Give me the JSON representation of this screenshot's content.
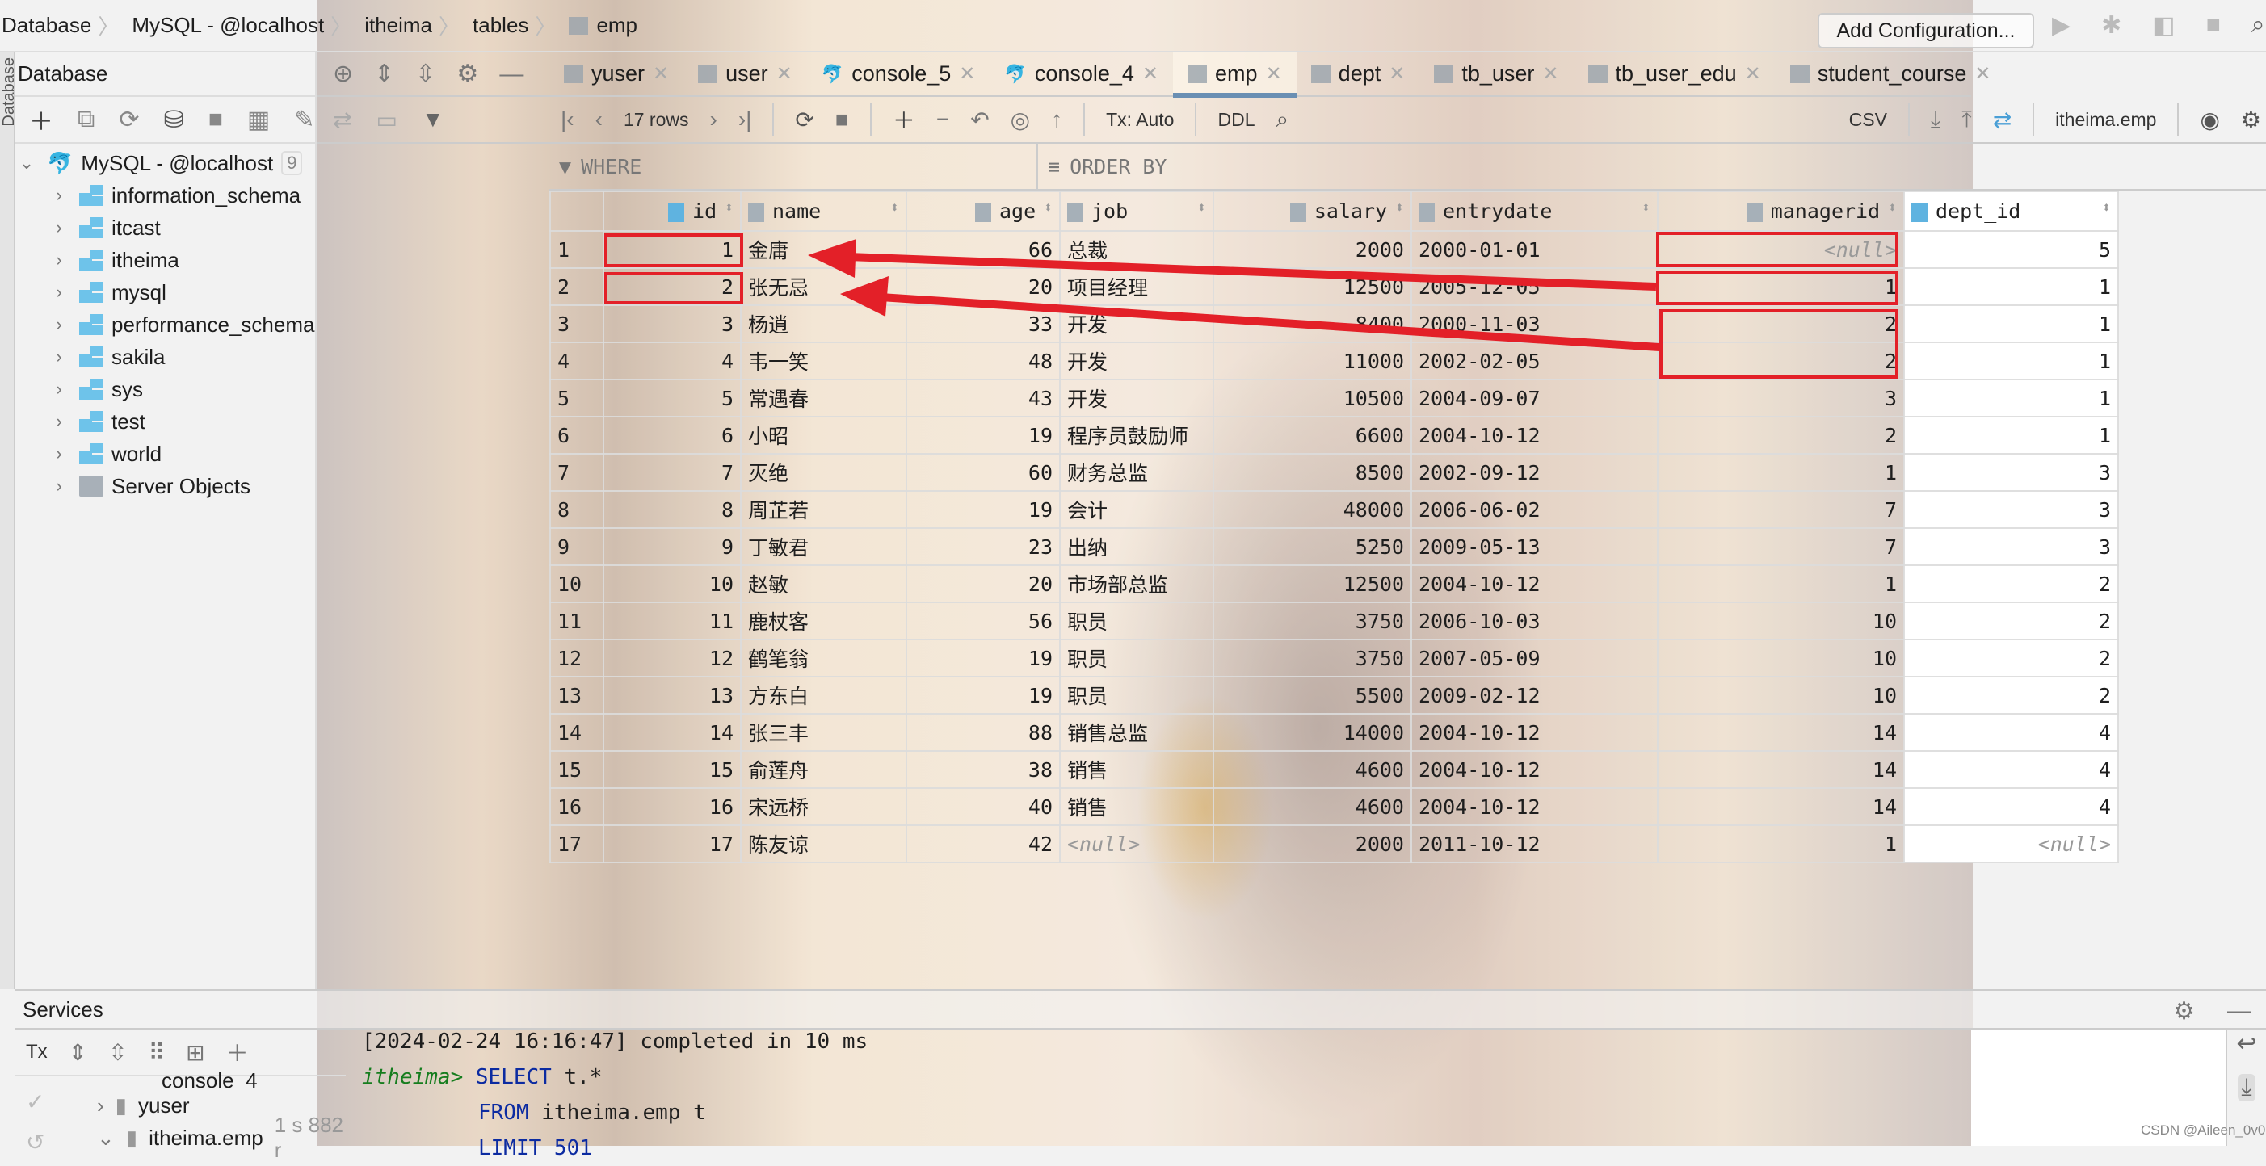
{
  "breadcrumb": [
    "Database",
    "MySQL - @localhost",
    "itheima",
    "tables",
    "emp"
  ],
  "top_toolbar": {
    "add_configuration": "Add Configuration...",
    "icons": [
      "run-icon",
      "debug-icon",
      "coverage-icon",
      "stop-icon",
      "search-icon"
    ]
  },
  "sidebar": {
    "title": "Database",
    "vertical_tab": "Database",
    "root": {
      "label": "MySQL - @localhost",
      "count": "9"
    },
    "schemas": [
      "information_schema",
      "itcast",
      "itheima",
      "mysql",
      "performance_schema",
      "sakila",
      "sys",
      "test",
      "world"
    ],
    "server_objects": "Server Objects"
  },
  "tabs": [
    {
      "label": "yuser",
      "icon": "table"
    },
    {
      "label": "user",
      "icon": "table"
    },
    {
      "label": "console_5",
      "icon": "console"
    },
    {
      "label": "console_4",
      "icon": "console"
    },
    {
      "label": "emp",
      "icon": "table",
      "active": true
    },
    {
      "label": "dept",
      "icon": "table"
    },
    {
      "label": "tb_user",
      "icon": "table"
    },
    {
      "label": "tb_user_edu",
      "icon": "table"
    },
    {
      "label": "student_course",
      "icon": "table"
    }
  ],
  "grid_toolbar": {
    "rows": "17 rows",
    "tx": "Tx: Auto",
    "ddl": "DDL",
    "export_format": "CSV",
    "data_source": "itheima.emp"
  },
  "filter": {
    "where": "WHERE",
    "order_by": "ORDER BY"
  },
  "table": {
    "columns": [
      "id",
      "name",
      "age",
      "job",
      "salary",
      "entrydate",
      "managerid",
      "dept_id"
    ],
    "rows": [
      [
        "1",
        "金庸",
        "66",
        "总裁",
        "2000",
        "2000-01-01",
        "<null>",
        "5"
      ],
      [
        "2",
        "张无忌",
        "20",
        "项目经理",
        "12500",
        "2005-12-05",
        "1",
        "1"
      ],
      [
        "3",
        "杨逍",
        "33",
        "开发",
        "8400",
        "2000-11-03",
        "2",
        "1"
      ],
      [
        "4",
        "韦一笑",
        "48",
        "开发",
        "11000",
        "2002-02-05",
        "2",
        "1"
      ],
      [
        "5",
        "常遇春",
        "43",
        "开发",
        "10500",
        "2004-09-07",
        "3",
        "1"
      ],
      [
        "6",
        "小昭",
        "19",
        "程序员鼓励师",
        "6600",
        "2004-10-12",
        "2",
        "1"
      ],
      [
        "7",
        "灭绝",
        "60",
        "财务总监",
        "8500",
        "2002-09-12",
        "1",
        "3"
      ],
      [
        "8",
        "周芷若",
        "19",
        "会计",
        "48000",
        "2006-06-02",
        "7",
        "3"
      ],
      [
        "9",
        "丁敏君",
        "23",
        "出纳",
        "5250",
        "2009-05-13",
        "7",
        "3"
      ],
      [
        "10",
        "赵敏",
        "20",
        "市场部总监",
        "12500",
        "2004-10-12",
        "1",
        "2"
      ],
      [
        "11",
        "鹿杖客",
        "56",
        "职员",
        "3750",
        "2006-10-03",
        "10",
        "2"
      ],
      [
        "12",
        "鹤笔翁",
        "19",
        "职员",
        "3750",
        "2007-05-09",
        "10",
        "2"
      ],
      [
        "13",
        "方东白",
        "19",
        "职员",
        "5500",
        "2009-02-12",
        "10",
        "2"
      ],
      [
        "14",
        "张三丰",
        "88",
        "销售总监",
        "14000",
        "2004-10-12",
        "14",
        "4"
      ],
      [
        "15",
        "俞莲舟",
        "38",
        "销售",
        "4600",
        "2004-10-12",
        "14",
        "4"
      ],
      [
        "16",
        "宋远桥",
        "40",
        "销售",
        "4600",
        "2004-10-12",
        "14",
        "4"
      ],
      [
        "17",
        "陈友谅",
        "42",
        "<null>",
        "2000",
        "2011-10-12",
        "1",
        "<null>"
      ]
    ]
  },
  "annotation_color": "#e32028",
  "services": {
    "title": "Services",
    "tx": "Tx",
    "tree": [
      {
        "label": "console_4"
      },
      {
        "label": "yuser"
      },
      {
        "label": "itheima.emp",
        "meta": "1 s 882 r"
      }
    ],
    "console": {
      "log": "[2024-02-24 16:16:47] completed in 10 ms",
      "prompt": "itheima>",
      "lines": [
        [
          "SELECT",
          " t.*"
        ],
        [
          "FROM",
          " itheima.emp t"
        ],
        [
          "LIMIT",
          " 501"
        ]
      ]
    }
  },
  "watermark": "CSDN @Aileen_0v0"
}
